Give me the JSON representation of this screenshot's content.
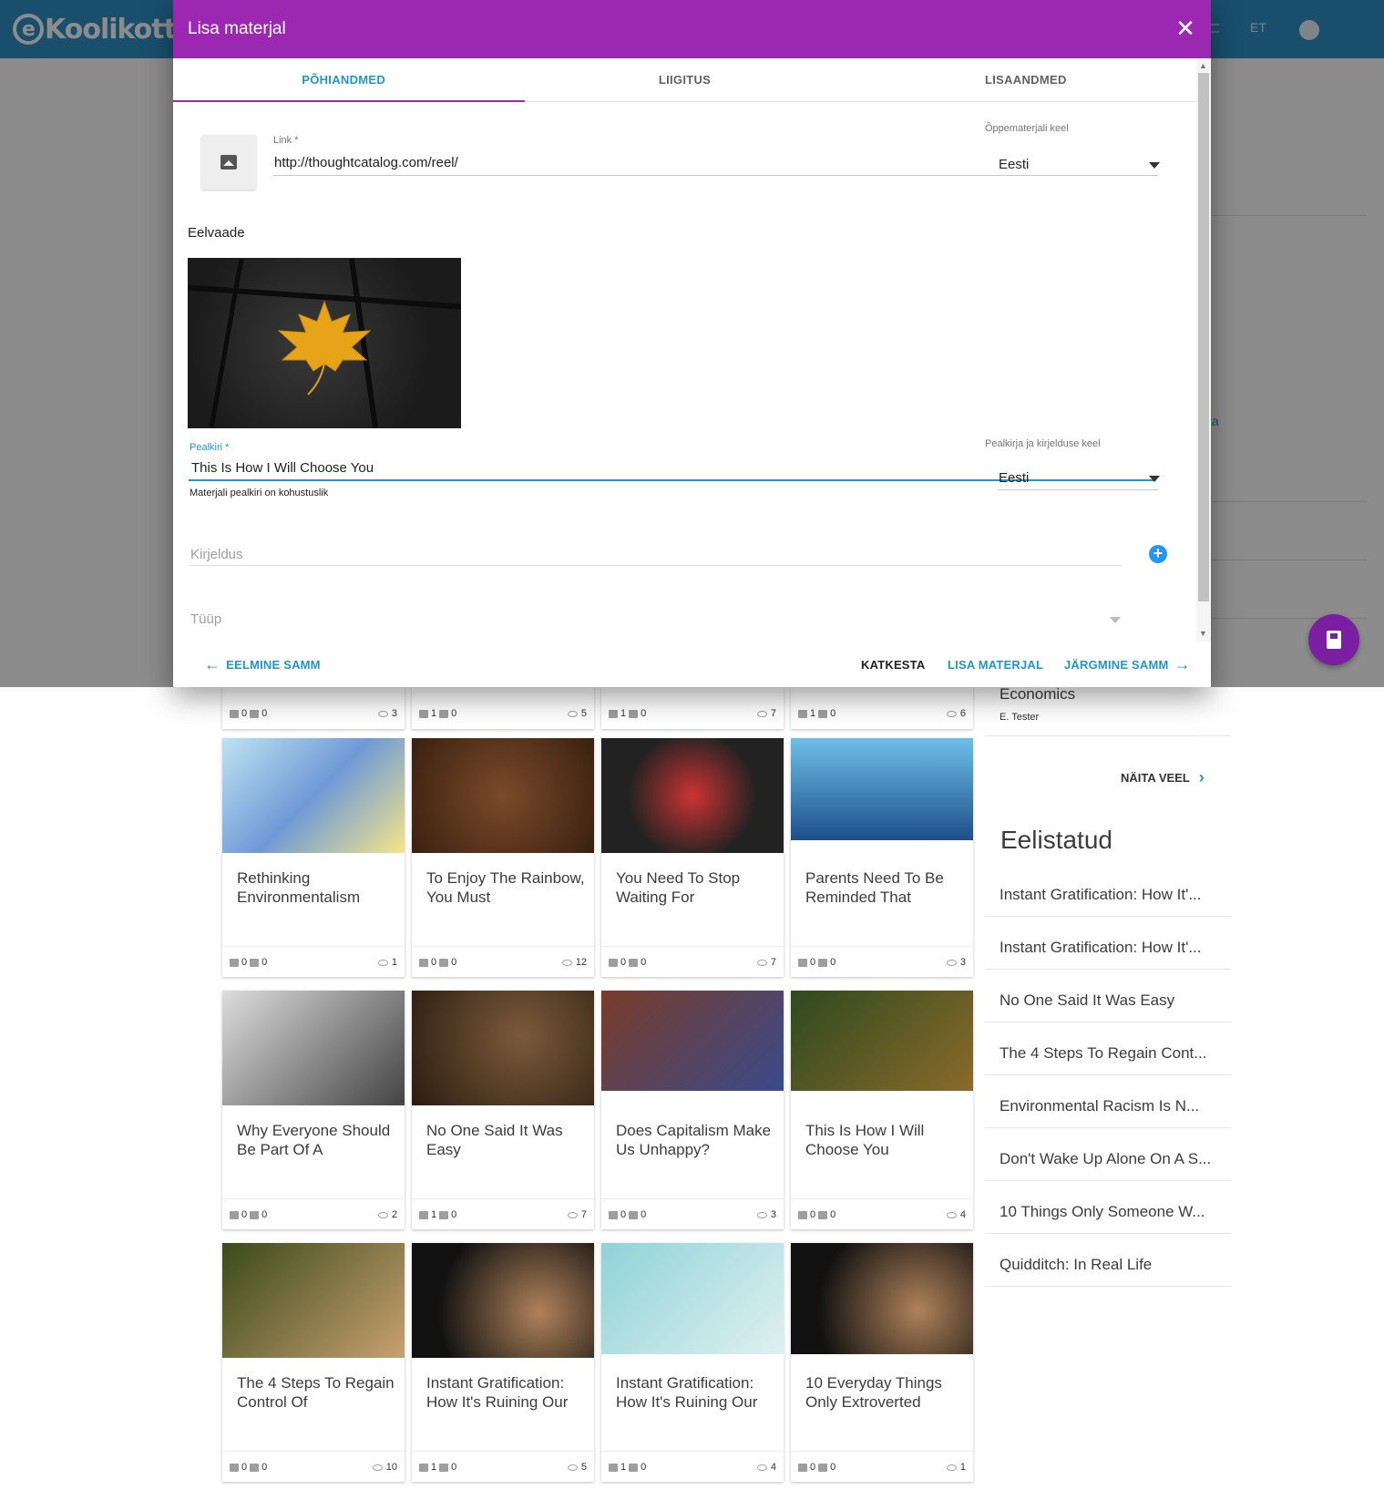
{
  "app": {
    "logo_text": "Koolikott",
    "logo_letter": "e",
    "lang": "ET"
  },
  "dialog": {
    "title": "Lisa materjal",
    "tabs": [
      {
        "label": "PÕHIANDMED",
        "active": true
      },
      {
        "label": "LIIGITUS",
        "active": false
      },
      {
        "label": "LISAANDMED",
        "active": false
      }
    ],
    "link": {
      "label": "Link *",
      "value": "http://thoughtcatalog.com/reel/"
    },
    "material_lang": {
      "label": "Õppematerjali keel",
      "value": "Eesti"
    },
    "preview_label": "Eelvaade",
    "headline": {
      "label": "Pealkiri *",
      "value": "This Is How I Will Choose You",
      "hint": "Materjali pealkiri on kohustuslik"
    },
    "headline_lang": {
      "label": "Pealkirja ja kirjelduse keel",
      "value": "Eesti"
    },
    "description": {
      "placeholder": "Kirjeldus"
    },
    "type": {
      "placeholder": "Tüüp"
    },
    "actions": {
      "prev": "EELMINE SAMM",
      "cancel": "KATKESTA",
      "add": "LISA MATERJAL",
      "next": "JÄRGMINE SAMM"
    }
  },
  "colors": {
    "dialog_header": "#9c27b0",
    "app_header": "#2e8fc7",
    "accent": "#2196c9",
    "fab": "#7b1fa2"
  },
  "top_card_footers": [
    {
      "up": "0",
      "down": "0",
      "views": "3"
    },
    {
      "up": "1",
      "down": "0",
      "views": "5"
    },
    {
      "up": "1",
      "down": "0",
      "views": "7"
    },
    {
      "up": "1",
      "down": "0",
      "views": "6"
    }
  ],
  "cards": [
    {
      "title": "Rethinking Environmentalism",
      "up": "0",
      "down": "0",
      "views": "1"
    },
    {
      "title": "To Enjoy The Rainbow, You Must",
      "up": "0",
      "down": "0",
      "views": "12"
    },
    {
      "title": "You Need To Stop Waiting For",
      "up": "0",
      "down": "0",
      "views": "7"
    },
    {
      "title": "Parents Need To Be Reminded That",
      "up": "0",
      "down": "0",
      "views": "3"
    },
    {
      "title": "Why Everyone Should Be Part Of A",
      "up": "0",
      "down": "0",
      "views": "2"
    },
    {
      "title": "No One Said It Was Easy",
      "up": "1",
      "down": "0",
      "views": "7"
    },
    {
      "title": "Does Capitalism Make Us Unhappy?",
      "up": "0",
      "down": "0",
      "views": "3"
    },
    {
      "title": "This Is How I Will Choose You",
      "up": "0",
      "down": "0",
      "views": "4"
    },
    {
      "title": "The 4 Steps To Regain Control Of",
      "up": "0",
      "down": "0",
      "views": "10"
    },
    {
      "title": "Instant Gratification: How It's Ruining Our",
      "up": "1",
      "down": "0",
      "views": "5"
    },
    {
      "title": "Instant Gratification: How It's Ruining Our",
      "up": "1",
      "down": "0",
      "views": "4"
    },
    {
      "title": "10 Everyday Things Only Extroverted",
      "up": "0",
      "down": "0",
      "views": "1"
    }
  ],
  "sidebar": {
    "top_item": {
      "title": "Economics",
      "author": "E. Tester"
    },
    "show_more": "NÄITA VEEL",
    "favorites_title": "Eelistatud",
    "favorites": [
      "Instant Gratification: How It'...",
      "Instant Gratification: How It'...",
      "No One Said It Was Easy",
      "The 4 Steps To Regain Cont...",
      "Environmental Racism Is N...",
      "Don't Wake Up Alone On A S...",
      "10 Things Only Someone W...",
      "Quidditch: In Real Life"
    ]
  }
}
